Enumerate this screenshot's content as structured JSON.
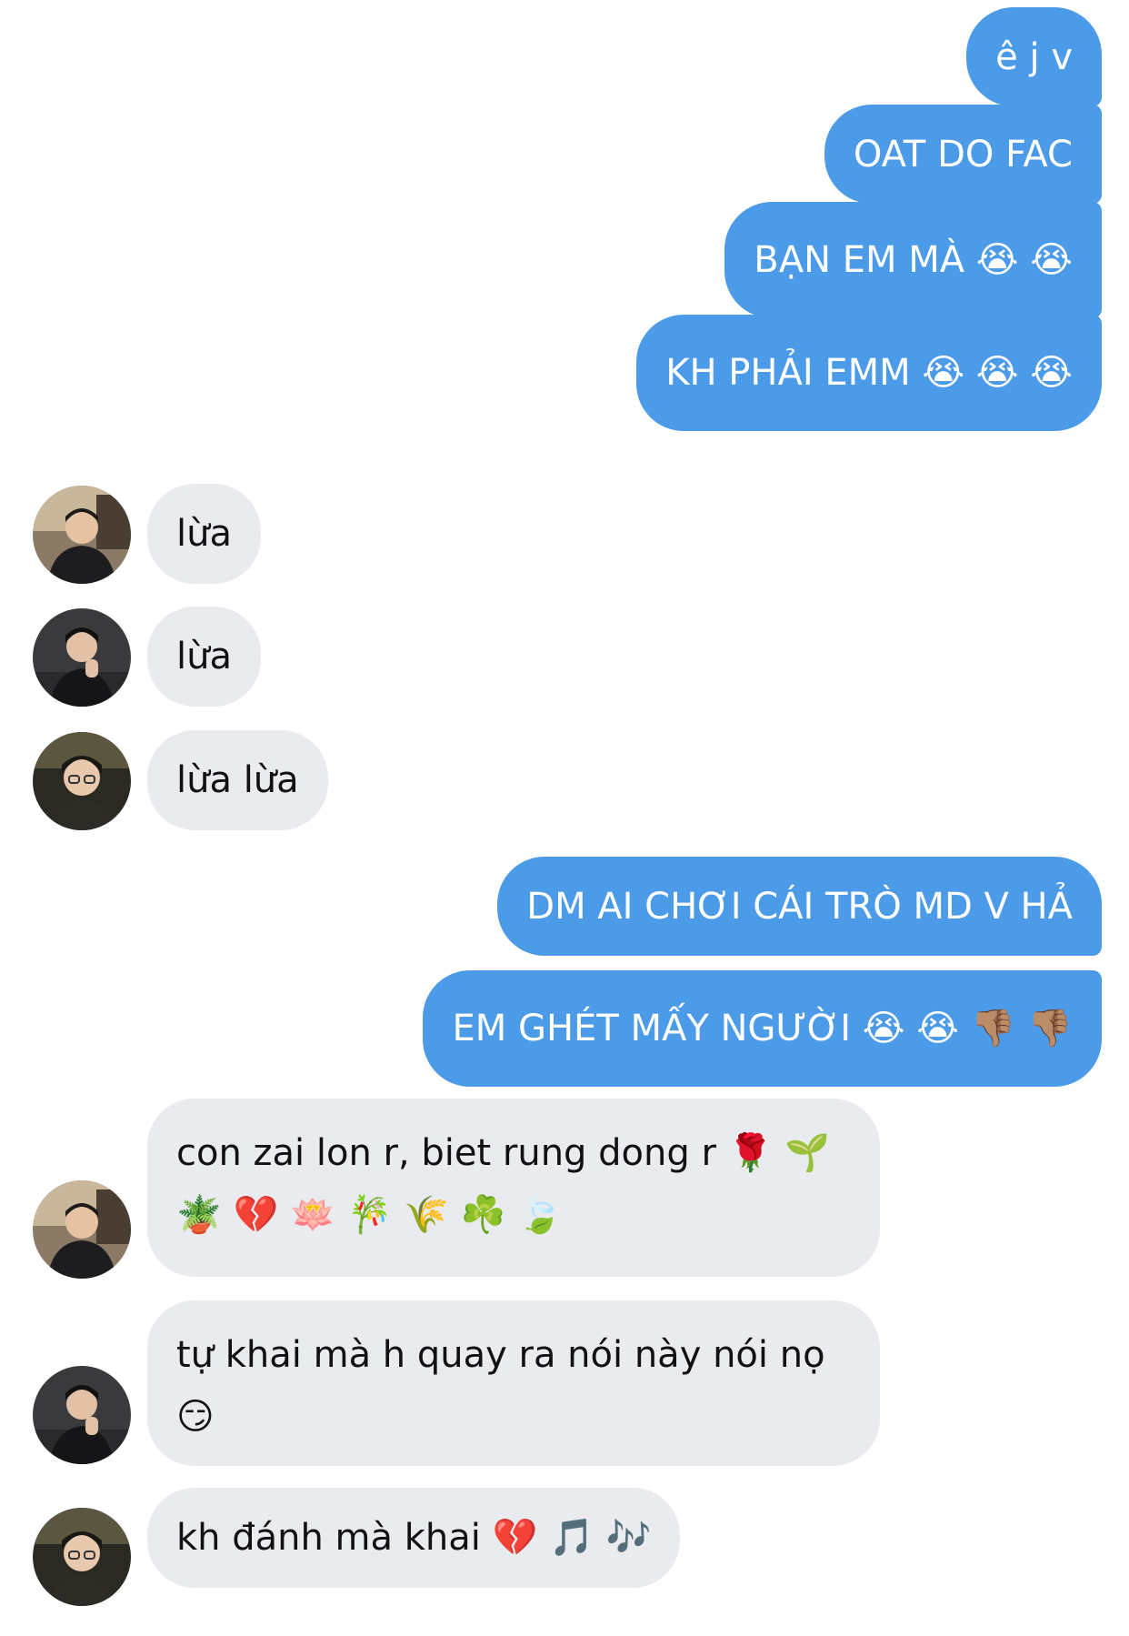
{
  "messages": [
    {
      "dir": "out",
      "text": "ê j v"
    },
    {
      "dir": "out",
      "text": "OAT DO FAC"
    },
    {
      "dir": "out",
      "text": "BẠN EM MÀ 😭 😭"
    },
    {
      "dir": "out",
      "text": "KH PHẢI EMM 😭 😭 😭"
    },
    {
      "dir": "in",
      "sender": "user-a",
      "text": "lừa"
    },
    {
      "dir": "in",
      "sender": "user-b",
      "text": "lừa"
    },
    {
      "dir": "in",
      "sender": "user-c",
      "text": "lừa lừa"
    },
    {
      "dir": "out",
      "text": "DM AI CHƠI CÁI TRÒ MD V HẢ"
    },
    {
      "dir": "out",
      "text": "EM GHÉT MẤY NGƯỜI 😭 😭 👎🏽 👎🏽"
    },
    {
      "dir": "in",
      "sender": "user-a",
      "text": "con zai lon r, biet rung dong r 🌹 🌱 🪴 💔 🪷 🎋 🌾 ☘️ 🍃"
    },
    {
      "dir": "in",
      "sender": "user-b",
      "text": "tự khai mà h quay ra nói này nói nọ 😏"
    },
    {
      "dir": "in",
      "sender": "user-c",
      "text": "kh đánh mà khai 💔 🎵 🎶"
    }
  ],
  "colors": {
    "outgoing_bubble": "#4c9be8",
    "incoming_bubble": "#e9ebef",
    "outgoing_text": "#ffffff",
    "incoming_text": "#111111"
  },
  "avatars": [
    {
      "sender": "user-a",
      "icon": "avatar-photo"
    },
    {
      "sender": "user-b",
      "icon": "avatar-photo"
    },
    {
      "sender": "user-c",
      "icon": "avatar-photo"
    }
  ]
}
